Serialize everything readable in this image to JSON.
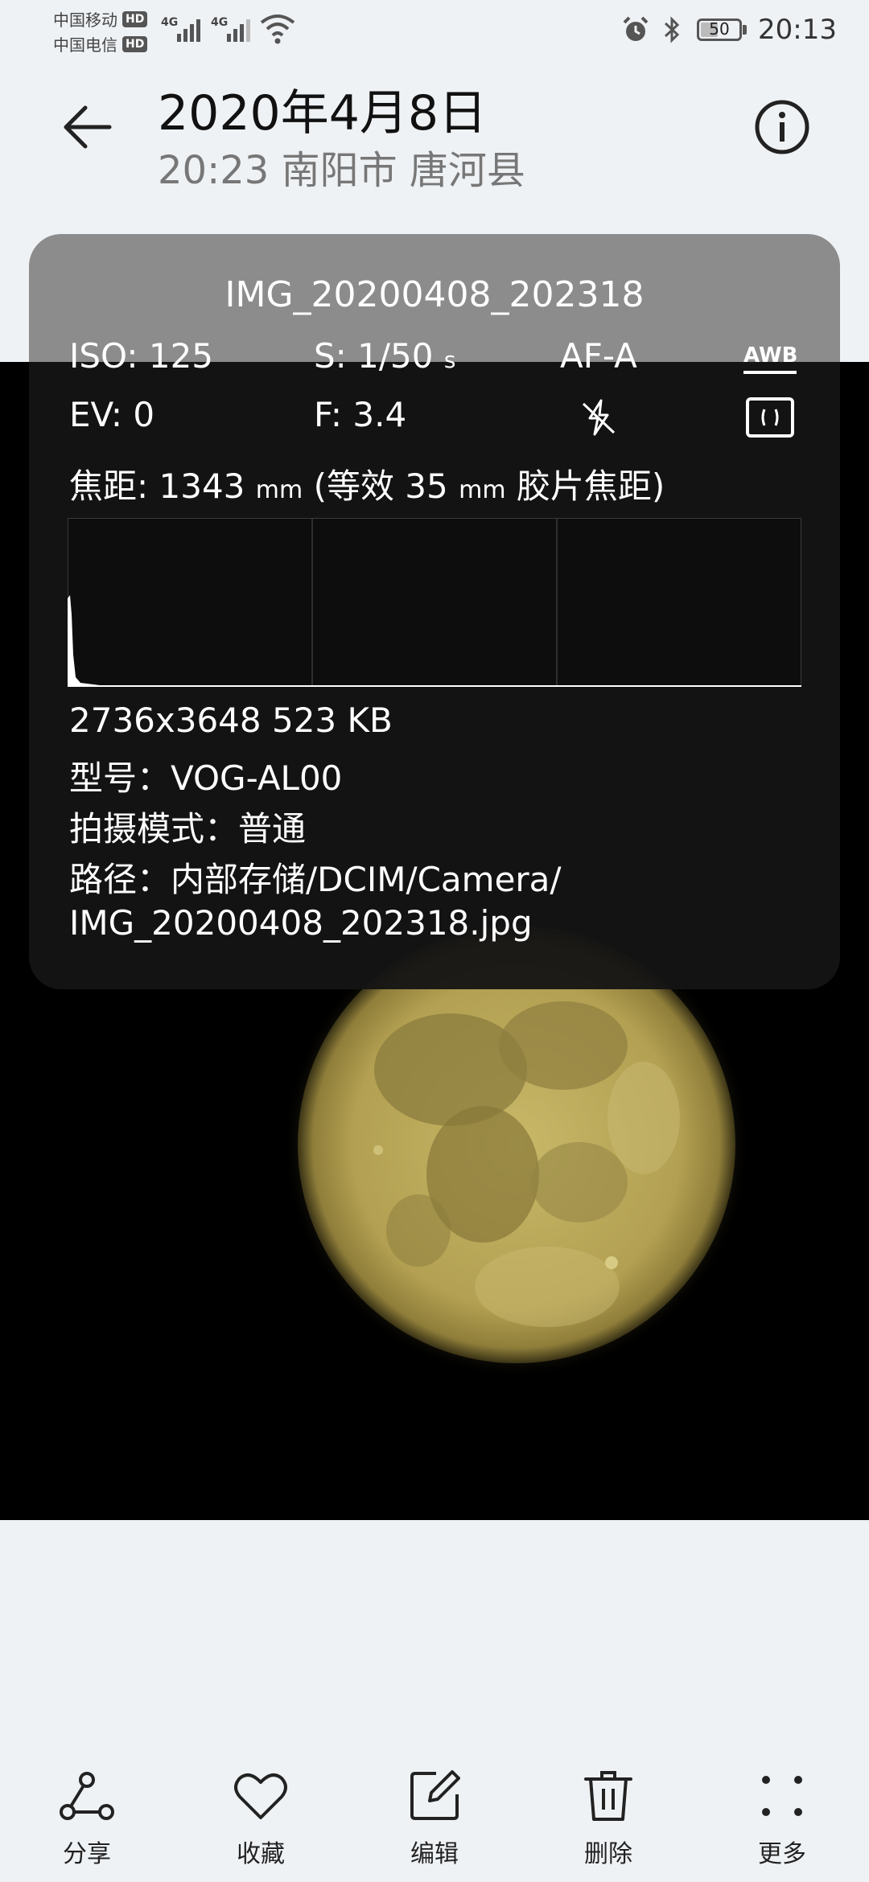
{
  "status_bar": {
    "carrier_1": "中国移动",
    "carrier_2": "中国电信",
    "hd_badge": "HD",
    "network_1": "4G",
    "network_2": "4G",
    "battery": "50",
    "battery_level": 0.5,
    "time": "20:13",
    "icons": [
      "alarm-icon",
      "bluetooth-icon",
      "wifi-icon",
      "signal-icon",
      "battery-icon"
    ]
  },
  "header": {
    "date": "2020年4月8日",
    "subtitle": "20:23  南阳市 唐河县",
    "icons": [
      "back-arrow-icon",
      "info-icon"
    ]
  },
  "info_panel": {
    "file_name": "IMG_20200408_202318",
    "iso": "ISO: 125",
    "shutter": "S: 1/50",
    "shutter_unit": "s",
    "af_mode": "AF-A",
    "awb": "AWB",
    "ev": "EV: 0",
    "aperture": "F: 3.4",
    "focal_prefix": "焦距: 1343",
    "focal_unit_1": "mm",
    "focal_middle": "(等效 35",
    "focal_unit_2": "mm",
    "focal_suffix": "胶片焦距)",
    "resolution_size": "2736x3648  523 KB",
    "model": "型号：VOG-AL00",
    "mode": "拍摄模式：普通",
    "path_line_1": "路径：内部存储/DCIM/Camera/",
    "path_line_2": "IMG_20200408_202318.jpg",
    "icons": [
      "flash-off-icon",
      "metering-icon"
    ]
  },
  "toolbar": {
    "share": "分享",
    "favorite": "收藏",
    "edit": "编辑",
    "delete": "删除",
    "more": "更多",
    "icons": [
      "share-icon",
      "heart-icon",
      "edit-icon",
      "trash-icon",
      "more-icon"
    ]
  },
  "colors": {
    "background": "#eff2f5",
    "panel_top": "#8c8c8c",
    "panel_body": "#141414",
    "moon": "#b9a85a"
  }
}
